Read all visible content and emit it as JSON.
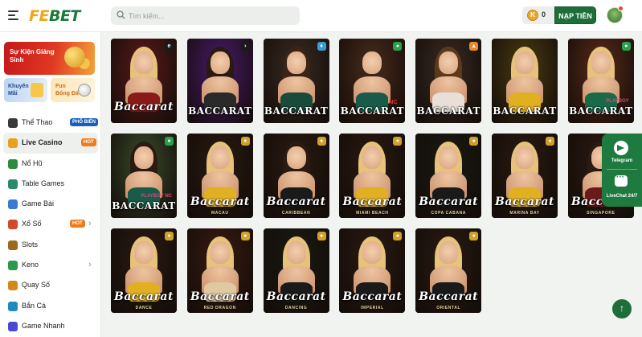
{
  "header": {
    "logo_fe": "FE",
    "logo_bet": "BET",
    "search_placeholder": "Tìm kiếm...",
    "balance": "0",
    "coin_symbol": "K",
    "deposit_label": "NẠP TIỀN"
  },
  "sidebar": {
    "promo_main": "Sự Kiện Giáng Sinh",
    "promo_a": "Khuyến Mãi",
    "promo_b": "Fun Bóng Đá",
    "items": [
      {
        "label": "Thể Thao",
        "tag": "PHỔ BIẾN",
        "icon": "soccer-ball-icon",
        "color": "#3a3a3a"
      },
      {
        "label": "Live Casino",
        "tag": "HOT",
        "icon": "casino-chip-icon",
        "color": "#e8a11a",
        "active": true
      },
      {
        "label": "Nổ Hũ",
        "icon": "jackpot-icon",
        "color": "#2e8a3e"
      },
      {
        "label": "Table Games",
        "icon": "table-games-icon",
        "color": "#2a8a6a"
      },
      {
        "label": "Game Bài",
        "icon": "cards-icon",
        "color": "#3a7ad1"
      },
      {
        "label": "Xổ Số",
        "tag": "HOT",
        "icon": "lottery-icon",
        "color": "#d14a2a",
        "chevron": true
      },
      {
        "label": "Slots",
        "icon": "slots-icon",
        "color": "#9a6a1a"
      },
      {
        "label": "Keno",
        "icon": "keno-icon",
        "color": "#2a9a4a",
        "chevron": true
      },
      {
        "label": "Quay Số",
        "icon": "wheel-icon",
        "color": "#d18a1a"
      },
      {
        "label": "Bắn Cá",
        "icon": "fish-icon",
        "color": "#1a8ac1"
      },
      {
        "label": "Game Nhanh",
        "icon": "fast-game-icon",
        "color": "#4a4ad1"
      }
    ]
  },
  "games": [
    {
      "title": "Baccarat",
      "style": "script",
      "sub": "",
      "badge": "e",
      "badge_color": "#1a1a1a",
      "bg": "#5a1a1a",
      "hair": "#e6c27a",
      "dress": "#8a1a1a"
    },
    {
      "title": "BACCARAT",
      "style": "caps",
      "sub": "",
      "badge": "›",
      "badge_color": "#1a1a1a",
      "bg": "#4a1a6a",
      "hair": "#2a1a12",
      "dress": "#2a2a2a"
    },
    {
      "title": "BACCARAT",
      "style": "caps",
      "sub": "",
      "badge": "♦",
      "badge_color": "#3a9ad1",
      "bg": "#3a2a22",
      "hair": "#3a2418",
      "dress": "#1a4a3a"
    },
    {
      "title": "BACCARAT",
      "style": "caps",
      "sub": "",
      "badge": "●",
      "badge_color": "#2aa04a",
      "bg": "#4a2a1a",
      "hair": "#3a2418",
      "dress": "#1a5a4a",
      "nc": "NC"
    },
    {
      "title": "BACCARAT",
      "style": "caps",
      "sub": "",
      "badge": "▲",
      "badge_color": "#e88a2a",
      "bg": "#3a2a22",
      "hair": "#5a3a1a",
      "dress": "#e8e0d8"
    },
    {
      "title": "BACCARAT",
      "style": "caps",
      "sub": "",
      "badge": "",
      "badge_color": "",
      "bg": "#4a3a12",
      "hair": "#e6c27a",
      "dress": "#e0b020"
    },
    {
      "title": "BACCARAT",
      "style": "caps",
      "sub": "",
      "badge": "●",
      "badge_color": "#2aa04a",
      "bg": "#5a2a1a",
      "hair": "#e6c27a",
      "dress": "#1a6a4a",
      "playboy": "PLAYBOY"
    },
    {
      "title": "BACCARAT",
      "style": "caps",
      "sub": "",
      "badge": "●",
      "badge_color": "#2aa04a",
      "bg": "#3a4a2a",
      "hair": "#2a1a12",
      "dress": "#1a5a4a",
      "playboy": "PLAYBOY NC"
    },
    {
      "title": "Baccarat",
      "style": "script",
      "sub": "MACAU",
      "badge": "●",
      "badge_color": "#d1a02a",
      "bg": "#2a1a12",
      "hair": "#e6c27a",
      "dress": "#e0b020"
    },
    {
      "title": "Baccarat",
      "style": "script",
      "sub": "CARIBBEAN",
      "badge": "●",
      "badge_color": "#d1a02a",
      "bg": "#2a1a12",
      "hair": "#2a1a12",
      "dress": "#1a1a1a"
    },
    {
      "title": "Baccarat",
      "style": "script",
      "sub": "MIAMI BEACH",
      "badge": "●",
      "badge_color": "#d1a02a",
      "bg": "#2a1a12",
      "hair": "#e6c27a",
      "dress": "#e0b020"
    },
    {
      "title": "Baccarat",
      "style": "script",
      "sub": "COPA CABANA",
      "badge": "●",
      "badge_color": "#d1a02a",
      "bg": "#1a1a12",
      "hair": "#e6c27a",
      "dress": "#1a1a1a"
    },
    {
      "title": "Baccarat",
      "style": "script",
      "sub": "MARINA BAY",
      "badge": "●",
      "badge_color": "#d1a02a",
      "bg": "#2a1a12",
      "hair": "#e6c27a",
      "dress": "#e0b020"
    },
    {
      "title": "Baccarat",
      "style": "script",
      "sub": "SINGAPORE",
      "badge": "",
      "badge_color": "",
      "bg": "#2a1a12",
      "hair": "#2a1a12",
      "dress": "#6a1a1a"
    },
    {
      "title": "Baccarat",
      "style": "script",
      "sub": "DANCE",
      "badge": "●",
      "badge_color": "#d1a02a",
      "bg": "#2a1a12",
      "hair": "#e6c27a",
      "dress": "#e0b020"
    },
    {
      "title": "Baccarat",
      "style": "script",
      "sub": "RED DRAGON",
      "badge": "●",
      "badge_color": "#d1a02a",
      "bg": "#3a1a12",
      "hair": "#e6c27a",
      "dress": "#e0c8a0"
    },
    {
      "title": "Baccarat",
      "style": "script",
      "sub": "DANCING",
      "badge": "●",
      "badge_color": "#d1a02a",
      "bg": "#1a1a12",
      "hair": "#e6c27a",
      "dress": "#1a1a1a"
    },
    {
      "title": "Baccarat",
      "style": "script",
      "sub": "IMPERIAL",
      "badge": "●",
      "badge_color": "#d1a02a",
      "bg": "#2a1a12",
      "hair": "#e6c27a",
      "dress": "#1a1a1a"
    },
    {
      "title": "Baccarat",
      "style": "script",
      "sub": "ORIENTAL",
      "badge": "●",
      "badge_color": "#d1a02a",
      "bg": "#2a1a12",
      "hair": "#e6c27a",
      "dress": "#1a1a1a"
    }
  ],
  "float_widget": {
    "telegram_label": "Telegram",
    "livechat_label": "LiveChat 24/7"
  }
}
